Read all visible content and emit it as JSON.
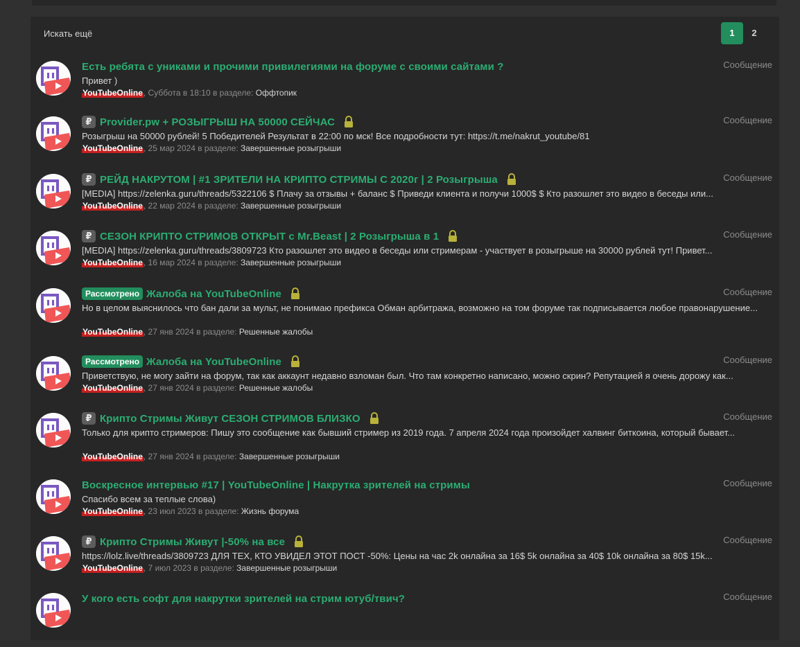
{
  "header": {
    "search_more": "Искать ещё",
    "pages": [
      "1",
      "2"
    ],
    "active_page": "1"
  },
  "colors": {
    "accent_green": "#228e5d",
    "title_green": "#2bad72",
    "username_highlight": "#c62020",
    "avatar_purple": "#7a58c2",
    "avatar_red": "#f05656",
    "lock": "#b9b23a"
  },
  "results": [
    {
      "prefix": "",
      "prefix_type": "none",
      "title": "Есть ребята с униками и прочими привилегиями на форуме с своими сайтами ?",
      "locked": false,
      "snippet": "Привет )",
      "user": "YouTubeOnline",
      "date": ", Суббота в 18:10 в разделе: ",
      "section": "Оффтопик",
      "type": "Сообщение"
    },
    {
      "prefix": "₽",
      "prefix_type": "gray",
      "title": "Provider.pw + РОЗЫГРЫШ НА 50000 СЕЙЧАС",
      "locked": true,
      "snippet": "Розыгрыш на 50000 рублей! 5 Победителей Результат в 22:00 по мск! Все подробности тут: https://t.me/nakrut_youtube/81",
      "user": "YouTubeOnline",
      "date": ", 25 мар 2024 в разделе: ",
      "section": "Завершенные розыгрыши",
      "type": "Сообщение"
    },
    {
      "prefix": "₽",
      "prefix_type": "gray",
      "title": "РЕЙД НАКРУТОМ | #1 ЗРИТЕЛИ НА КРИПТО СТРИМЫ С 2020г | 2 Розыгрыша",
      "locked": true,
      "snippet": "[MEDIA] https://zelenka.guru/threads/5322106 $ Плачу за отзывы + баланс $ Приведи клиента и получи 1000$ $ Кто разошлет это видео в беседы или...",
      "user": "YouTubeOnline",
      "date": ", 22 мар 2024 в разделе: ",
      "section": "Завершенные розыгрыши",
      "type": "Сообщение"
    },
    {
      "prefix": "₽",
      "prefix_type": "gray",
      "title": "СЕЗОН КРИПТО СТРИМОВ ОТКРЫТ с Mr.Beast | 2 Розыгрыша в 1",
      "locked": true,
      "snippet": "[MEDIA] https://zelenka.guru/threads/3809723 Кто разошлет это видео в беседы или стримерам - участвует в розыгрыше на 30000 рублей тут! Привет...",
      "user": "YouTubeOnline",
      "date": ", 16 мар 2024 в разделе: ",
      "section": "Завершенные розыгрыши",
      "type": "Сообщение"
    },
    {
      "prefix": "Рассмотрено",
      "prefix_type": "green",
      "title": "Жалоба на YouTubeOnline",
      "locked": true,
      "snippet": "Но в целом выяснилось что бан дали за мульт, не понимаю префикса Обман арбитража, возможно на том форуме так подписывается любое правонарушение...",
      "user": "YouTubeOnline",
      "date": ", 27 янв 2024 в разделе: ",
      "section": "Решенные жалобы",
      "type": "Сообщение"
    },
    {
      "prefix": "Рассмотрено",
      "prefix_type": "green",
      "title": "Жалоба на YouTubeOnline",
      "locked": true,
      "snippet": "Приветствую, не могу зайти на форум, так как аккаунт недавно взломан был. Что там конкретно написано, можно скрин? Репутацией я очень дорожу как...",
      "user": "YouTubeOnline",
      "date": ", 27 янв 2024 в разделе: ",
      "section": "Решенные жалобы",
      "type": "Сообщение"
    },
    {
      "prefix": "₽",
      "prefix_type": "gray",
      "title": "Крипто Стримы Живут СЕЗОН СТРИМОВ БЛИЗКО",
      "locked": true,
      "snippet": "Только для крипто стримеров: Пишу это сообщение как бывший стример из 2019 года. 7 апреля 2024 года произойдет халвинг биткоина, который бывает...",
      "user": "YouTubeOnline",
      "date": ", 27 янв 2024 в разделе: ",
      "section": "Завершенные розыгрыши",
      "type": "Сообщение"
    },
    {
      "prefix": "",
      "prefix_type": "none",
      "title": "Воскресное интервью #17 | YouTubeOnline | Накрутка зрителей на стримы",
      "locked": false,
      "snippet": "Спасибо всем за теплые слова)",
      "user": "YouTubeOnline",
      "date": ", 23 июл 2023 в разделе: ",
      "section": "Жизнь форума",
      "type": "Сообщение"
    },
    {
      "prefix": "₽",
      "prefix_type": "gray",
      "title": "Крипто Стримы Живут |-50% на все",
      "locked": true,
      "snippet": "https://lolz.live/threads/3809723 ДЛЯ ТЕХ, КТО УВИДЕЛ ЭТОТ ПОСТ -50%: Цены на час 2k онлайна за 16$ 5k онлайна за 40$ 10k онлайна за 80$ 15k...",
      "user": "YouTubeOnline",
      "date": ", 7 июл 2023 в разделе: ",
      "section": "Завершенные розыгрыши",
      "type": "Сообщение"
    },
    {
      "prefix": "",
      "prefix_type": "none",
      "title": "У кого есть софт для накрутки зрителей на стрим ютуб/твич?",
      "locked": false,
      "snippet": "",
      "user": "",
      "date": "",
      "section": "",
      "type": "Сообщение"
    }
  ]
}
